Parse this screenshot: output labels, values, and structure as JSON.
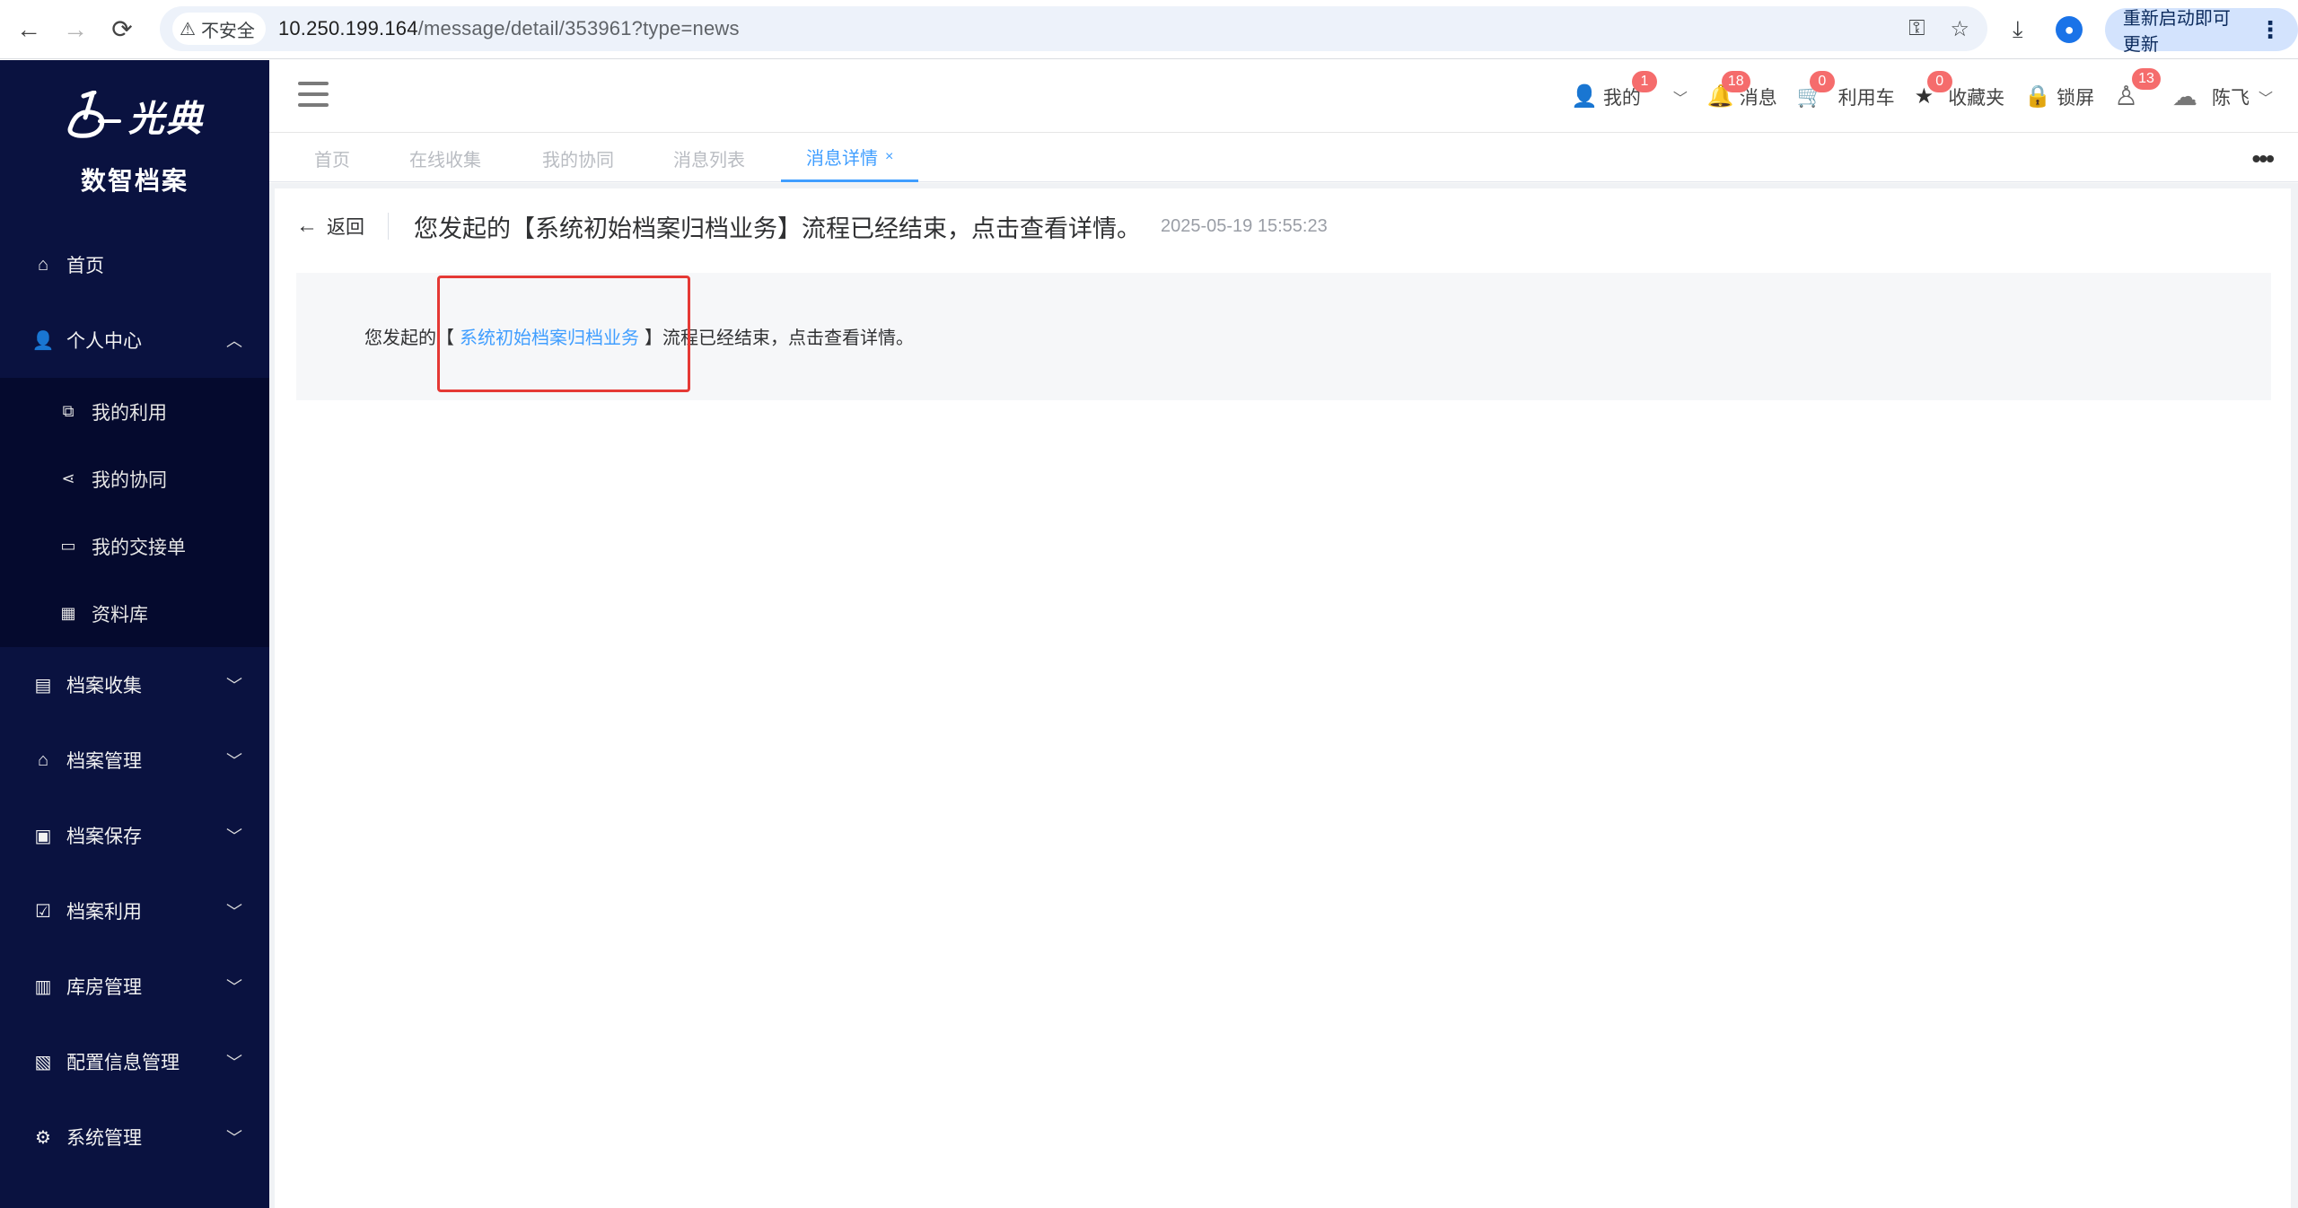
{
  "browser": {
    "security_label": "不安全",
    "url_host": "10.250.199.164",
    "url_path": "/message/detail/353961?type=news",
    "update_button": "重新启动即可更新"
  },
  "sidebar": {
    "logo_text": "光典",
    "system_name": "数智档案",
    "items": [
      {
        "label": "首页",
        "icon": "home-icon"
      },
      {
        "label": "个人中心",
        "icon": "user-icon",
        "expanded": true,
        "children": [
          {
            "label": "我的利用",
            "icon": "external-doc-icon"
          },
          {
            "label": "我的协同",
            "icon": "share-icon"
          },
          {
            "label": "我的交接单",
            "icon": "form-icon"
          },
          {
            "label": "资料库",
            "icon": "calendar-icon"
          }
        ]
      },
      {
        "label": "档案收集",
        "icon": "archive-box-icon"
      },
      {
        "label": "档案管理",
        "icon": "bank-icon"
      },
      {
        "label": "档案保存",
        "icon": "building-icon"
      },
      {
        "label": "档案利用",
        "icon": "clipboard-check-icon"
      },
      {
        "label": "库房管理",
        "icon": "office-icon"
      },
      {
        "label": "配置信息管理",
        "icon": "clipboard-icon"
      },
      {
        "label": "系统管理",
        "icon": "gear-icon"
      }
    ]
  },
  "topbar": {
    "mine_label": "我的",
    "mine_badge": "1",
    "messages_label": "消息",
    "messages_badge": "18",
    "cart_label": "利用车",
    "cart_badge": "0",
    "favorites_label": "收藏夹",
    "favorites_badge": "0",
    "lock_label": "锁屏",
    "users_badge": "13",
    "user_name": "陈飞"
  },
  "tabs": [
    {
      "label": "首页",
      "active": false
    },
    {
      "label": "在线收集",
      "active": false
    },
    {
      "label": "我的协同",
      "active": false
    },
    {
      "label": "消息列表",
      "active": false
    },
    {
      "label": "消息详情",
      "active": true,
      "close": "×"
    }
  ],
  "detail": {
    "back_label": "返回",
    "title": "您发起的【系统初始档案归档业务】流程已经结束，点击查看详情。",
    "time": "2025-05-19 15:55:23",
    "body_prefix": "您发起的",
    "bracket_open": "【",
    "link_text": "系统初始档案归档业务",
    "bracket_close": "】",
    "body_suffix": "流程已经结束，点击查看详情。"
  }
}
